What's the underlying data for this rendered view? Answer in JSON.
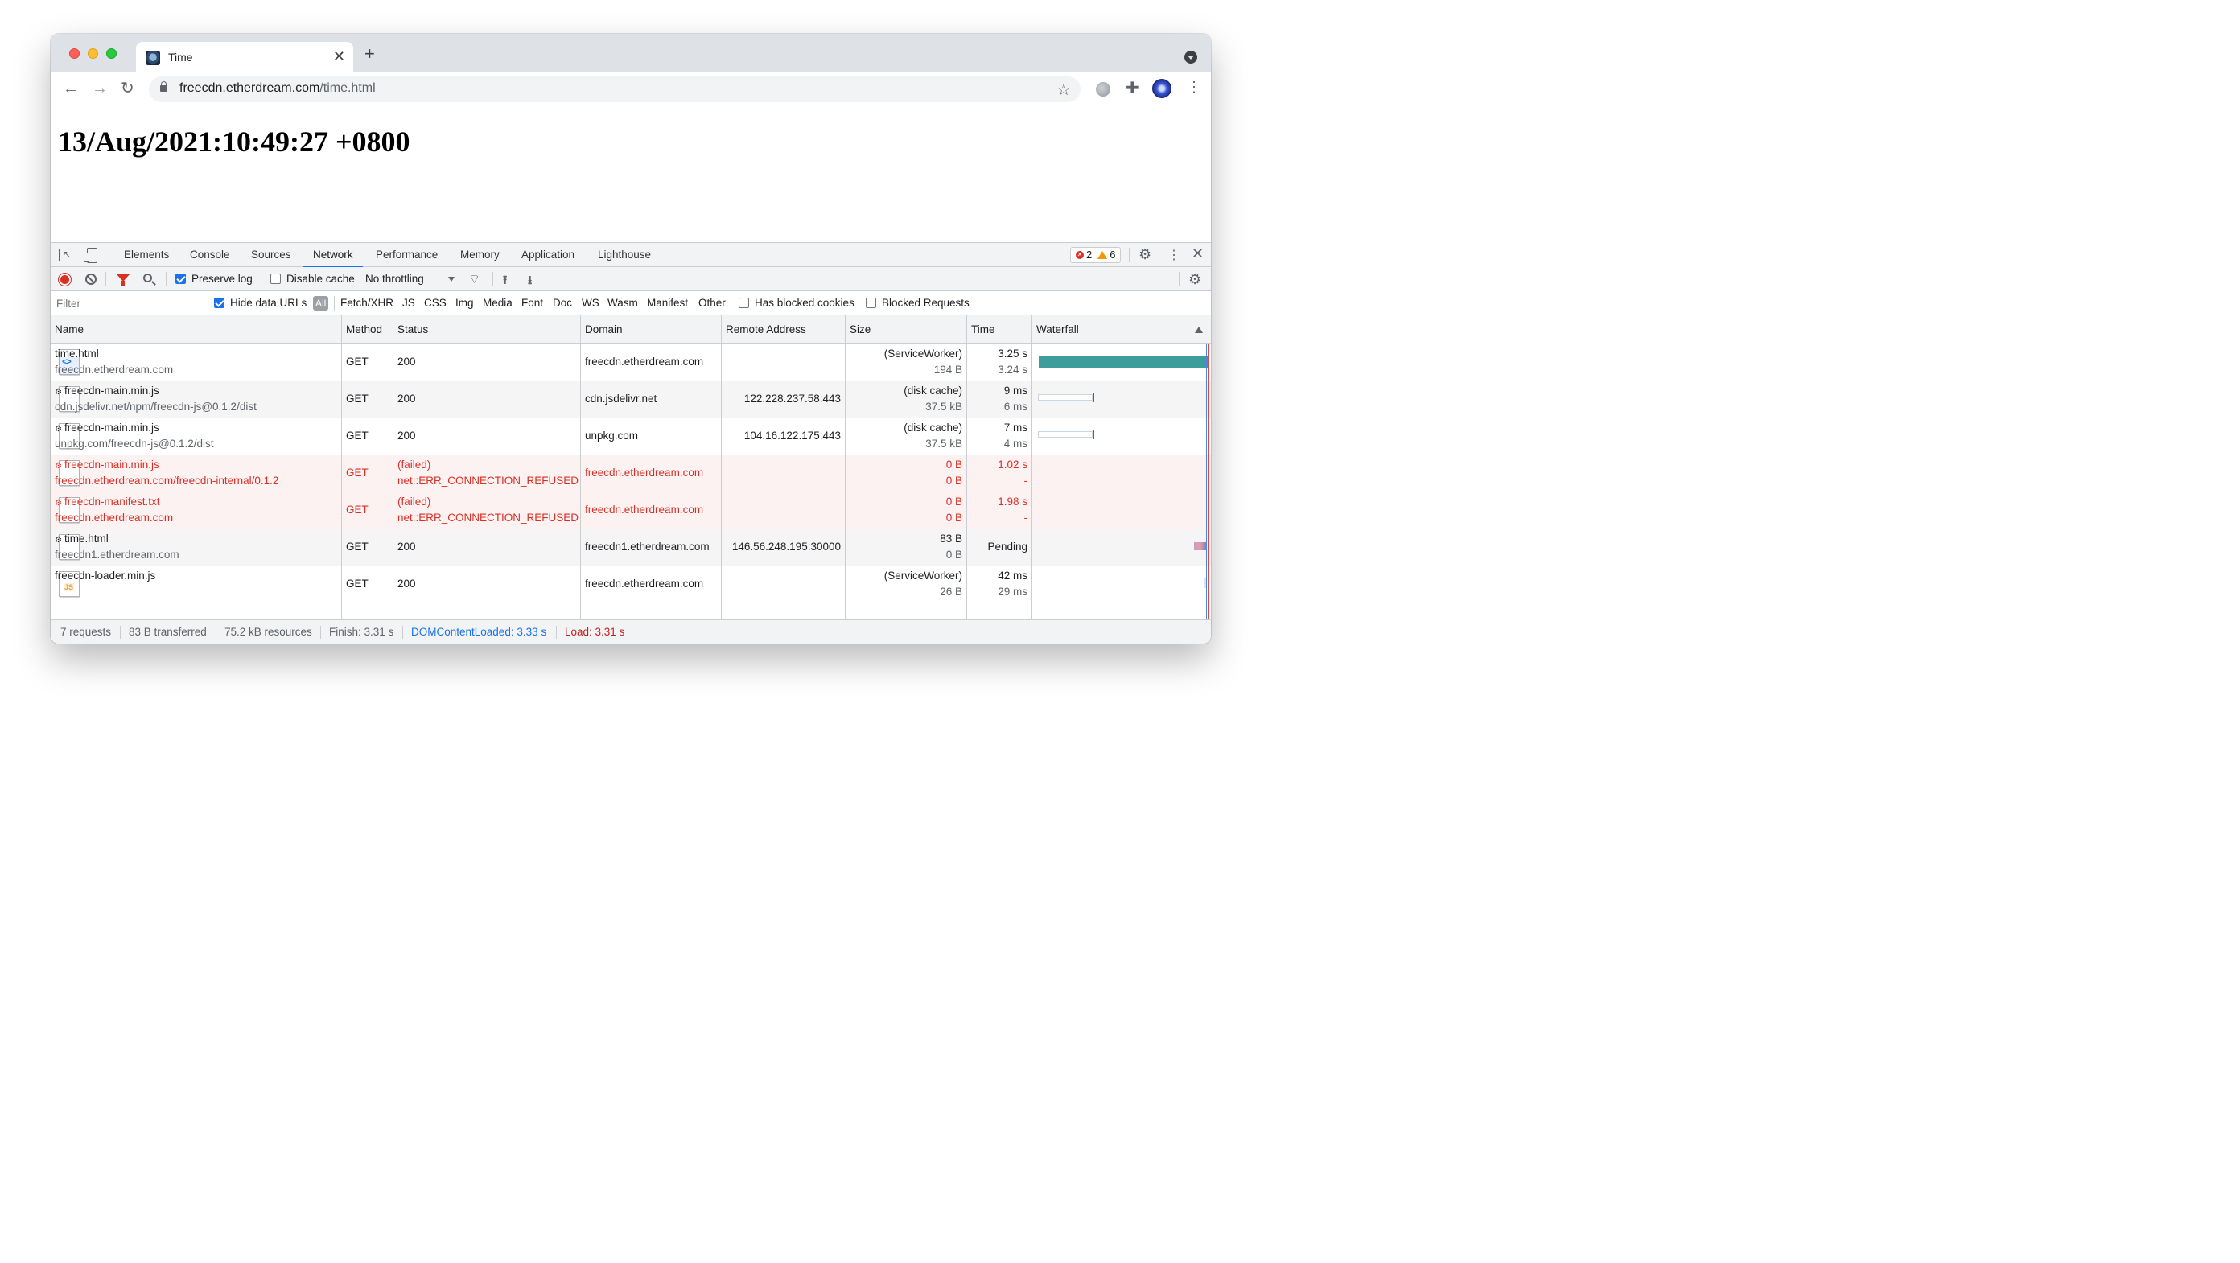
{
  "browser": {
    "tab_title": "Time",
    "url_host": "freecdn.etherdream.com",
    "url_path": "/time.html"
  },
  "page": {
    "heading": "13/Aug/2021:10:49:27 +0800"
  },
  "devtools": {
    "tabs": [
      "Elements",
      "Console",
      "Sources",
      "Network",
      "Performance",
      "Memory",
      "Application",
      "Lighthouse"
    ],
    "active_tab": "Network",
    "errors_count": "2",
    "warnings_count": "6",
    "toolbar": {
      "preserve_log": "Preserve log",
      "disable_cache": "Disable cache",
      "throttling": "No throttling"
    },
    "filter": {
      "placeholder": "Filter",
      "hide_data_urls": "Hide data URLs",
      "types": [
        "All",
        "Fetch/XHR",
        "JS",
        "CSS",
        "Img",
        "Media",
        "Font",
        "Doc",
        "WS",
        "Wasm",
        "Manifest",
        "Other"
      ],
      "has_blocked_cookies": "Has blocked cookies",
      "blocked_requests": "Blocked Requests"
    },
    "columns": [
      "Name",
      "Method",
      "Status",
      "Domain",
      "Remote Address",
      "Size",
      "Time",
      "Waterfall"
    ],
    "rows": [
      {
        "name": "time.html",
        "sub": "freecdn.etherdream.com",
        "method": "GET",
        "status": "200",
        "status2": "",
        "domain": "freecdn.etherdream.com",
        "remote": "",
        "size1": "(ServiceWorker)",
        "size2": "194 B",
        "time1": "3.25 s",
        "time2": "3.24 s",
        "failed": false,
        "icon": "html",
        "sw": false
      },
      {
        "name": "freecdn-main.min.js",
        "sub": "cdn.jsdelivr.net/npm/freecdn-js@0.1.2/dist",
        "method": "GET",
        "status": "200",
        "status2": "",
        "domain": "cdn.jsdelivr.net",
        "remote": "122.228.237.58:443",
        "size1": "(disk cache)",
        "size2": "37.5 kB",
        "time1": "9 ms",
        "time2": "6 ms",
        "failed": false,
        "icon": "blank",
        "sw": true
      },
      {
        "name": "freecdn-main.min.js",
        "sub": "unpkg.com/freecdn-js@0.1.2/dist",
        "method": "GET",
        "status": "200",
        "status2": "",
        "domain": "unpkg.com",
        "remote": "104.16.122.175:443",
        "size1": "(disk cache)",
        "size2": "37.5 kB",
        "time1": "7 ms",
        "time2": "4 ms",
        "failed": false,
        "icon": "blank",
        "sw": true
      },
      {
        "name": "freecdn-main.min.js",
        "sub": "freecdn.etherdream.com/freecdn-internal/0.1.2",
        "method": "GET",
        "status": "(failed)",
        "status2": "net::ERR_CONNECTION_REFUSED",
        "domain": "freecdn.etherdream.com",
        "remote": "",
        "size1": "0 B",
        "size2": "0 B",
        "time1": "1.02 s",
        "time2": "-",
        "failed": true,
        "icon": "blank",
        "sw": true
      },
      {
        "name": "freecdn-manifest.txt",
        "sub": "freecdn.etherdream.com",
        "method": "GET",
        "status": "(failed)",
        "status2": "net::ERR_CONNECTION_REFUSED",
        "domain": "freecdn.etherdream.com",
        "remote": "",
        "size1": "0 B",
        "size2": "0 B",
        "time1": "1.98 s",
        "time2": "-",
        "failed": true,
        "icon": "blank",
        "sw": true
      },
      {
        "name": "time.html",
        "sub": "freecdn1.etherdream.com",
        "method": "GET",
        "status": "200",
        "status2": "",
        "domain": "freecdn1.etherdream.com",
        "remote": "146.56.248.195:30000",
        "size1": "83 B",
        "size2": "0 B",
        "time1": "Pending",
        "time2": "",
        "failed": false,
        "icon": "blank",
        "sw": true
      },
      {
        "name": "freecdn-loader.min.js",
        "sub": "",
        "method": "GET",
        "status": "200",
        "status2": "",
        "domain": "freecdn.etherdream.com",
        "remote": "",
        "size1": "(ServiceWorker)",
        "size2": "26 B",
        "time1": "42 ms",
        "time2": "29 ms",
        "failed": false,
        "icon": "js",
        "sw": false
      }
    ],
    "status": {
      "requests": "7 requests",
      "transferred": "83 B transferred",
      "resources": "75.2 kB resources",
      "finish": "Finish: 3.31 s",
      "dom_loaded": "DOMContentLoaded: 3.33 s",
      "load": "Load: 3.31 s"
    }
  }
}
